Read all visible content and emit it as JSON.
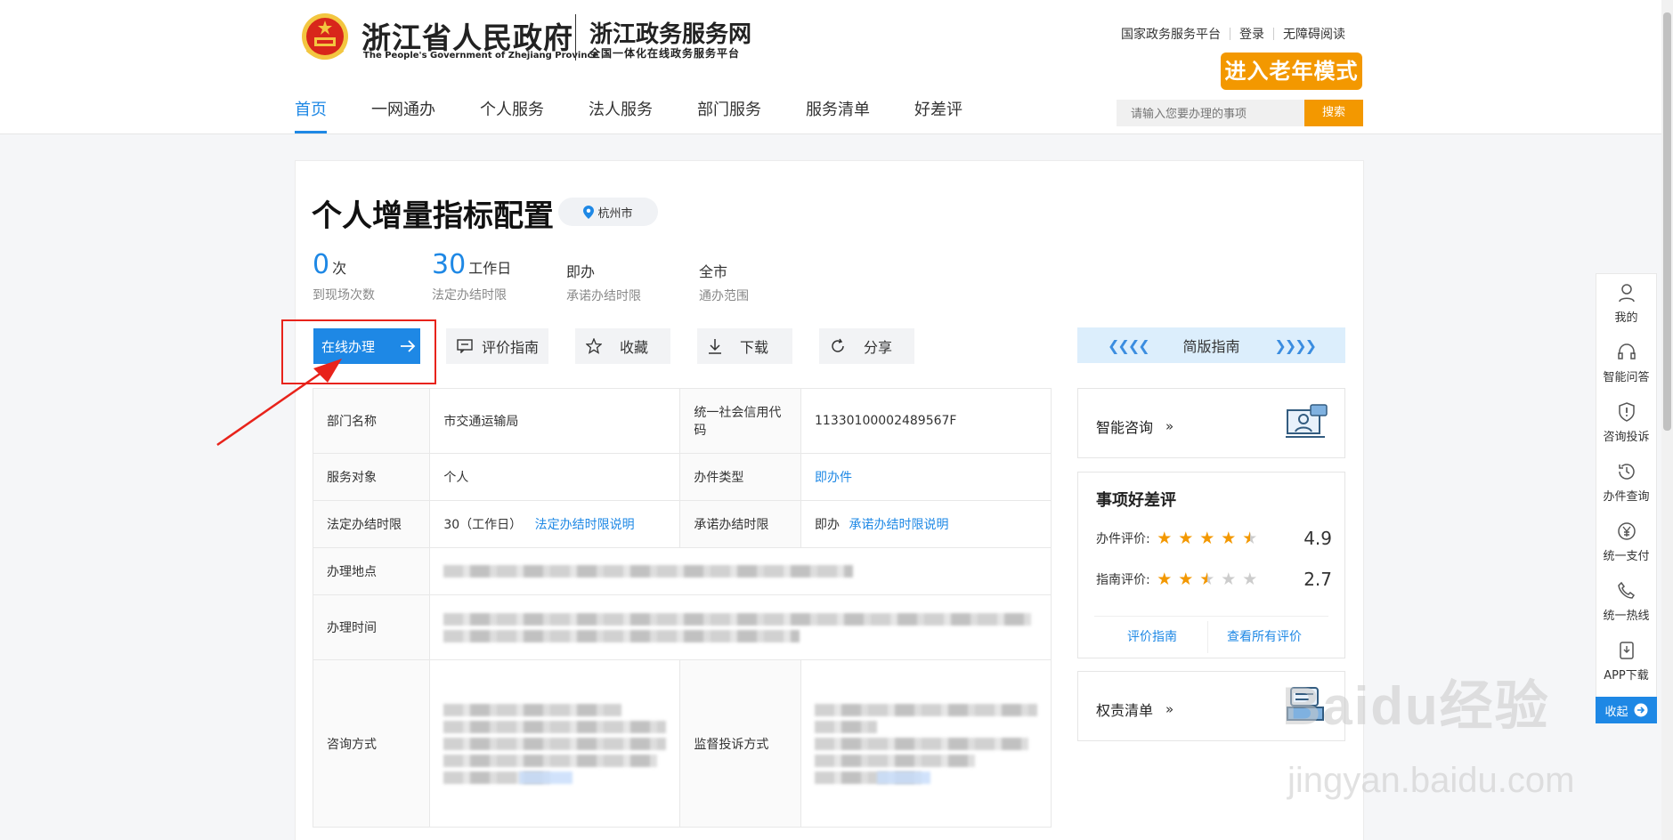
{
  "header": {
    "gov_title": "浙江省人民政府",
    "gov_subtitle": "The People's Government of Zhejiang Province",
    "service_title": "浙江政务服务网",
    "service_subtitle": "全国一体化在线政务服务平台",
    "top_links": [
      "国家政务服务平台",
      "登录",
      "无障碍阅读"
    ],
    "elder_mode": "进入老年模式",
    "nav": [
      "首页",
      "一网通办",
      "个人服务",
      "法人服务",
      "部门服务",
      "服务清单",
      "好差评"
    ],
    "active_nav": "首页",
    "search_placeholder": "请输入您要办理的事项",
    "search_button": "搜索"
  },
  "item": {
    "title": "个人增量指标配置",
    "city": "杭州市",
    "stats": [
      {
        "num": "0",
        "unit": "次",
        "label": "到现场次数"
      },
      {
        "num": "30",
        "unit": "工作日",
        "label": "法定办结时限"
      },
      {
        "value": "即办",
        "label": "承诺办结时限"
      },
      {
        "value": "全市",
        "label": "通办范围"
      }
    ]
  },
  "actions": {
    "online": "在线办理",
    "evaluate_guide": "评价指南",
    "favorite": "收藏",
    "download": "下载",
    "share": "分享",
    "simple_guide": "简版指南"
  },
  "table": {
    "dept_label": "部门名称",
    "dept_value": "市交通运输局",
    "credit_label": "统一社会信用代码",
    "credit_value": "11330100002489567F",
    "target_label": "服务对象",
    "target_value": "个人",
    "type_label": "办件类型",
    "type_value": "即办件",
    "legal_label": "法定办结时限",
    "legal_value": "30（工作日）",
    "legal_link": "法定办结时限说明",
    "promise_label": "承诺办结时限",
    "promise_value": "即办",
    "promise_link": "承诺办结时限说明",
    "place_label": "办理地点",
    "time_label": "办理时间",
    "consult_label": "咨询方式",
    "supervise_label": "监督投诉方式"
  },
  "side": {
    "smart_consult": "智能咨询",
    "rating_title": "事项好差评",
    "handle_rating_label": "办件评价:",
    "handle_rating_score": "4.9",
    "handle_rating_value": 4.9,
    "guide_rating_label": "指南评价:",
    "guide_rating_score": "2.7",
    "guide_rating_value": 2.7,
    "rating_guide_link": "评价指南",
    "all_reviews_link": "查看所有评价",
    "power_list": "权责清单"
  },
  "float_bar": {
    "items": [
      "我的",
      "智能问答",
      "咨询投诉",
      "办件查询",
      "统一支付",
      "统一热线",
      "APP下载"
    ],
    "collapse": "收起"
  },
  "watermark": {
    "main": "Baidu经验",
    "sub": "jingyan.baidu.com"
  },
  "colors": {
    "accent": "#1e88e5",
    "orange": "#f39800",
    "highlight": "#e8231b"
  }
}
